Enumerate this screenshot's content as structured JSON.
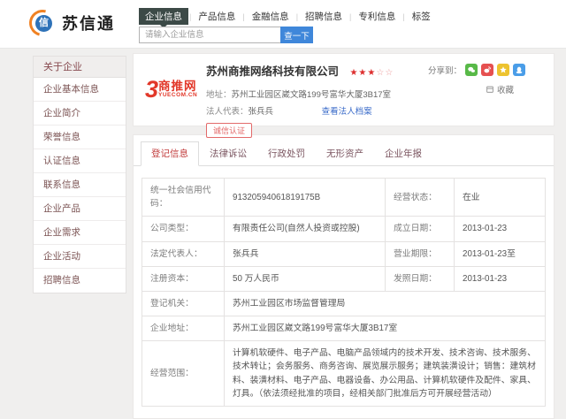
{
  "brand": {
    "name": "苏信通",
    "icon_char": "信",
    "accent_orange": "#f08122",
    "accent_blue": "#2e72b8"
  },
  "top_nav": {
    "separator": "|",
    "items": [
      {
        "label": "企业信息",
        "active": true
      },
      {
        "label": "产品信息",
        "active": false
      },
      {
        "label": "金融信息",
        "active": false
      },
      {
        "label": "招聘信息",
        "active": false
      },
      {
        "label": "专利信息",
        "active": false
      },
      {
        "label": "标签",
        "active": false
      }
    ]
  },
  "search": {
    "placeholder": "请输入企业信息",
    "button_label": "查一下",
    "button_color": "#3f87da"
  },
  "sidebar": {
    "title": "关于企业",
    "items": [
      "企业基本信息",
      "企业简介",
      "荣誉信息",
      "认证信息",
      "联系信息",
      "企业产品",
      "企业需求",
      "企业活动",
      "招聘信息"
    ]
  },
  "company": {
    "logo_num": "3",
    "logo_text": "商推网",
    "logo_sub": "YUECOM.CN",
    "name": "苏州商推网络科技有限公司",
    "rating_filled": "★★★",
    "rating_empty": "☆☆",
    "address_label": "地址：",
    "address": "苏州工业园区崴文路199号富华大厦3B17室",
    "legal_label": "法人代表：",
    "legal_name": "张兵兵",
    "legal_link": "查看法人档案",
    "cert_badge": "诚信认证",
    "share_label": "分享到：",
    "share_icons": [
      {
        "name": "wechat",
        "color": "#58b948"
      },
      {
        "name": "weibo",
        "color": "#e65050"
      },
      {
        "name": "qzone",
        "color": "#edc32f"
      },
      {
        "name": "qq",
        "color": "#4a9de8"
      }
    ],
    "favorite_label": "收藏"
  },
  "tabs": [
    {
      "label": "登记信息",
      "active": true
    },
    {
      "label": "法律诉讼",
      "active": false
    },
    {
      "label": "行政处罚",
      "active": false
    },
    {
      "label": "无形资产",
      "active": false
    },
    {
      "label": "企业年报",
      "active": false
    }
  ],
  "registration_table": {
    "rows": [
      {
        "cells": [
          {
            "label": "统一社会信用代码：",
            "value": "91320594061819175B"
          },
          {
            "label": "经营状态：",
            "value": "在业"
          }
        ]
      },
      {
        "cells": [
          {
            "label": "公司类型：",
            "value": "有限责任公司(自然人投资或控股)"
          },
          {
            "label": "成立日期：",
            "value": "2013-01-23"
          }
        ]
      },
      {
        "cells": [
          {
            "label": "法定代表人：",
            "value": "张兵兵"
          },
          {
            "label": "营业期限：",
            "value": "2013-01-23至"
          }
        ]
      },
      {
        "cells": [
          {
            "label": "注册资本：",
            "value": "50 万人民币"
          },
          {
            "label": "发照日期：",
            "value": "2013-01-23"
          }
        ]
      },
      {
        "cells": [
          {
            "label": "登记机关：",
            "value": "苏州工业园区市场监督管理局",
            "span": true
          }
        ]
      },
      {
        "cells": [
          {
            "label": "企业地址：",
            "value": "苏州工业园区崴文路199号富华大厦3B17室",
            "span": true
          }
        ]
      },
      {
        "cells": [
          {
            "label": "经营范围：",
            "value": "计算机软硬件、电子产品、电脑产品领域内的技术开发、技术咨询、技术服务、技术转让；会务服务、商务咨询、展览展示服务；建筑装潢设计；销售：建筑材料、装潢材料、电子产品、电器设备、办公用品、计算机软硬件及配件、家具、灯具。（依法须经批准的项目，经相关部门批准后方可开展经营活动）",
            "span": true
          }
        ]
      }
    ]
  }
}
